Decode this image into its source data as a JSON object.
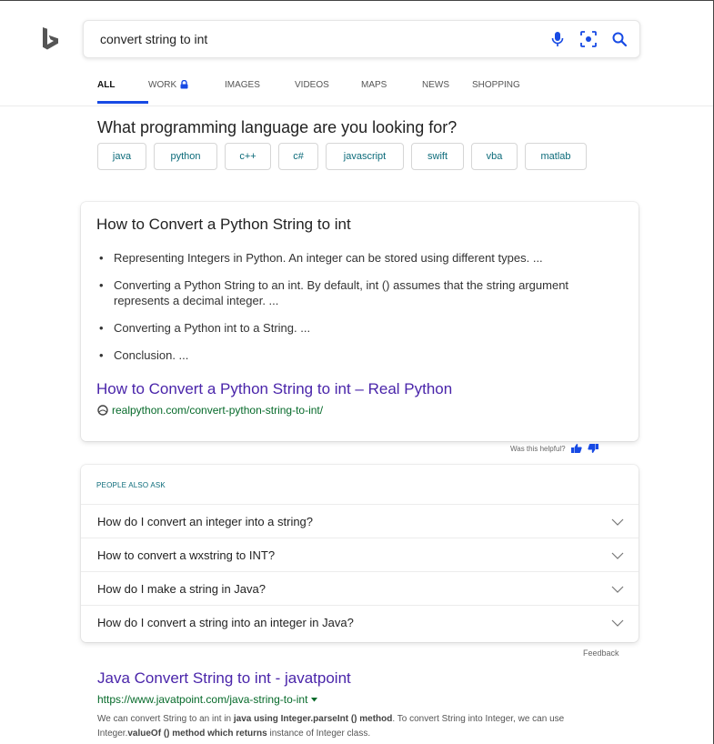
{
  "search": {
    "query": "convert string to int"
  },
  "tabs": [
    {
      "label": "ALL"
    },
    {
      "label": "WORK"
    },
    {
      "label": "IMAGES"
    },
    {
      "label": "VIDEOS"
    },
    {
      "label": "MAPS"
    },
    {
      "label": "NEWS"
    },
    {
      "label": "SHOPPING"
    }
  ],
  "language_prompt": {
    "question": "What programming language are you looking for?",
    "options": [
      "java",
      "python",
      "c++",
      "c#",
      "javascript",
      "swift",
      "vba",
      "matlab"
    ]
  },
  "answer": {
    "title": "How to Convert a Python String to int",
    "bullets": [
      "Representing Integers in Python. An integer can be stored using different types. ...",
      "Converting a Python String to an int. By default, int () assumes that the string argument represents a decimal integer. ...",
      "Converting a Python int to a String. ...",
      "Conclusion. ..."
    ],
    "link_title": "How to Convert a Python String to int – Real Python",
    "link_url": "realpython.com/convert-python-string-to-int/",
    "helpful_text": "Was this helpful?"
  },
  "people_also_ask": {
    "heading": "PEOPLE ALSO ASK",
    "questions": [
      "How do I convert an integer into a string?",
      "How to convert a wxstring to INT?",
      "How do I make a string in Java?",
      "How do I convert a string into an integer in Java?"
    ],
    "feedback": "Feedback"
  },
  "result": {
    "title": "Java Convert String to int - javatpoint",
    "url": "https://www.javatpoint.com/java-string-to-int",
    "snippet": [
      {
        "t": "We can convert String to an int in ",
        "b": false
      },
      {
        "t": "java using Integer.parseInt () method",
        "b": true
      },
      {
        "t": ". To convert String into Integer, we can use Integer.",
        "b": false
      },
      {
        "t": "valueOf () method which returns",
        "b": true
      },
      {
        "t": " instance of Integer class.",
        "b": false
      }
    ]
  },
  "colors": {
    "link": "#4a25aa",
    "url_green": "#066a2a",
    "accent_blue": "#174ae4",
    "chip_text": "#0c6b7a",
    "bing_logo": "#555555"
  }
}
